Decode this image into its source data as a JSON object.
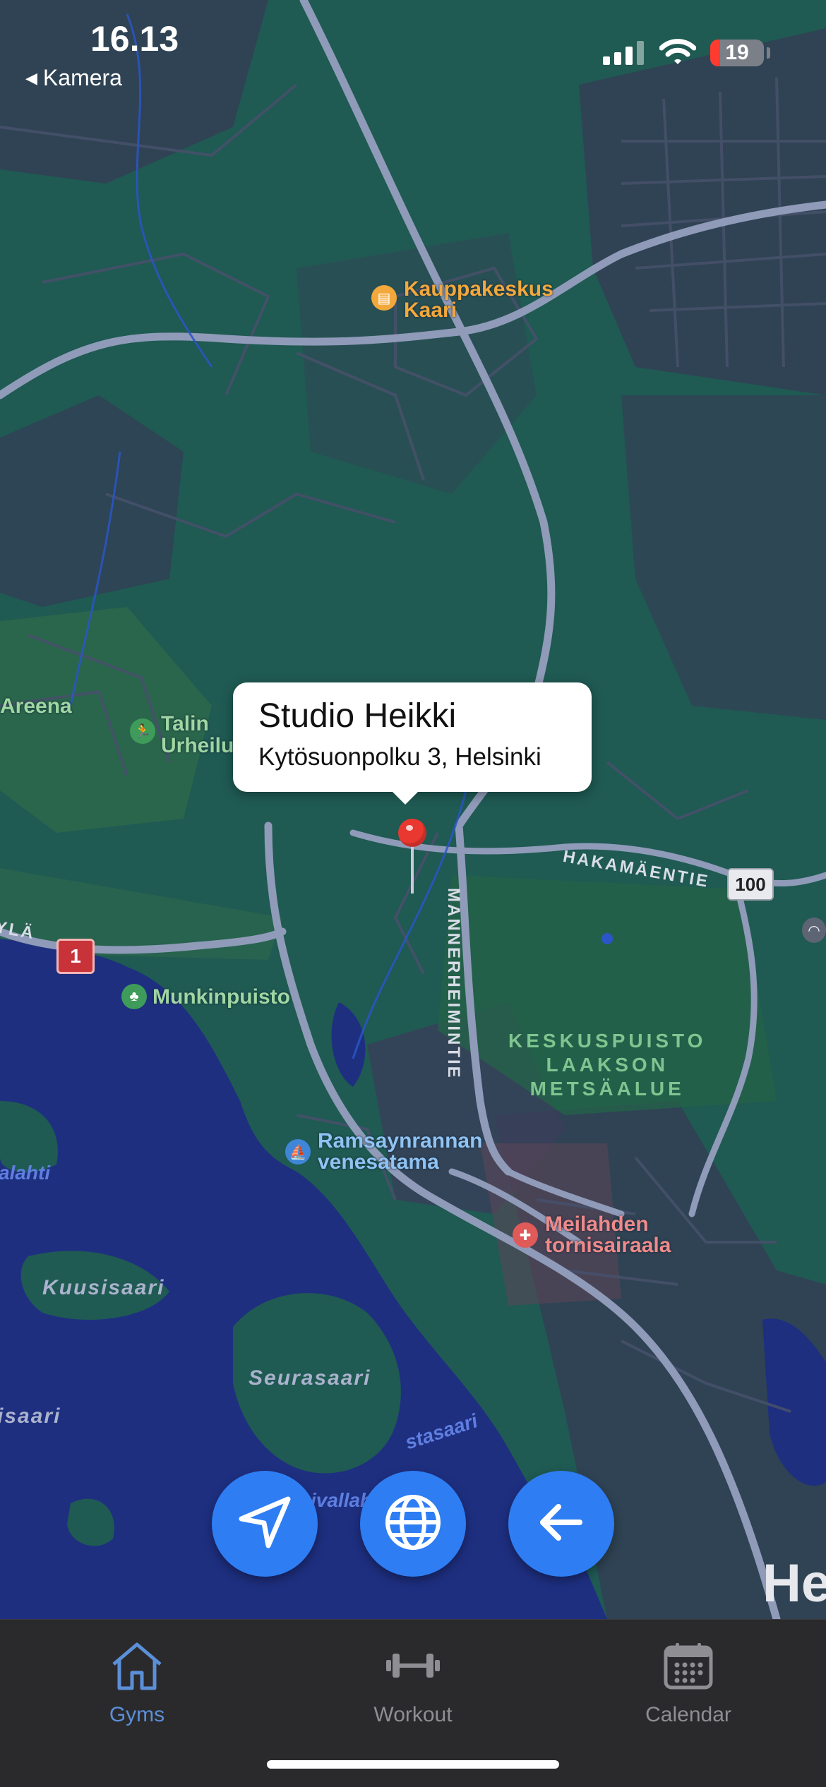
{
  "status_bar": {
    "time": "16.13",
    "back_label": "Kamera",
    "battery": "19",
    "battery_level": 0.19
  },
  "map": {
    "pois": {
      "mall": "Kauppakeskus\nKaari",
      "arena": "Areena",
      "sports_park": "Talin\nUrheilu",
      "park": "Munkinpuisto",
      "marina": "Ramsaynrannan\nvenesatama",
      "hospital": "Meilahden\ntornisairaala"
    },
    "areas": {
      "keskuspuisto": "KESKUSPUISTO\nLAAKSON\nMETSÄALUE"
    },
    "roads": {
      "hakamaentie": "HAKAMÄENTIE",
      "mannerheimintie": "MANNERHEIMINTIE",
      "ryla": "YLÄ"
    },
    "shields": {
      "route_100": "100",
      "route_1": "1"
    },
    "places": {
      "kuusisaari": "Kuusisaari",
      "seurasaari": "Seurasaari",
      "isaari": "isaari",
      "alahti": "alahti",
      "helsinki": "He"
    },
    "water_labels": {
      "stasaari": "stasaari",
      "ivallah": "ivallah"
    }
  },
  "callout": {
    "title": "Studio Heikki",
    "address": "Kytösuonpolku 3, Helsinki"
  },
  "actions": {
    "locate": "location-arrow-icon",
    "globe": "globe-icon",
    "back": "arrow-left-icon"
  },
  "tabs": [
    {
      "label": "Gyms",
      "icon": "house-icon",
      "active": true
    },
    {
      "label": "Workout",
      "icon": "dumbbell-icon",
      "active": false
    },
    {
      "label": "Calendar",
      "icon": "calendar-icon",
      "active": false
    }
  ],
  "colors": {
    "accent": "#2f7df3",
    "tab_active": "#5b8fd8",
    "tab_inactive": "#8e8e93",
    "land": "#1f5a53",
    "water": "#1e2f80",
    "pin": "#e8382f"
  }
}
